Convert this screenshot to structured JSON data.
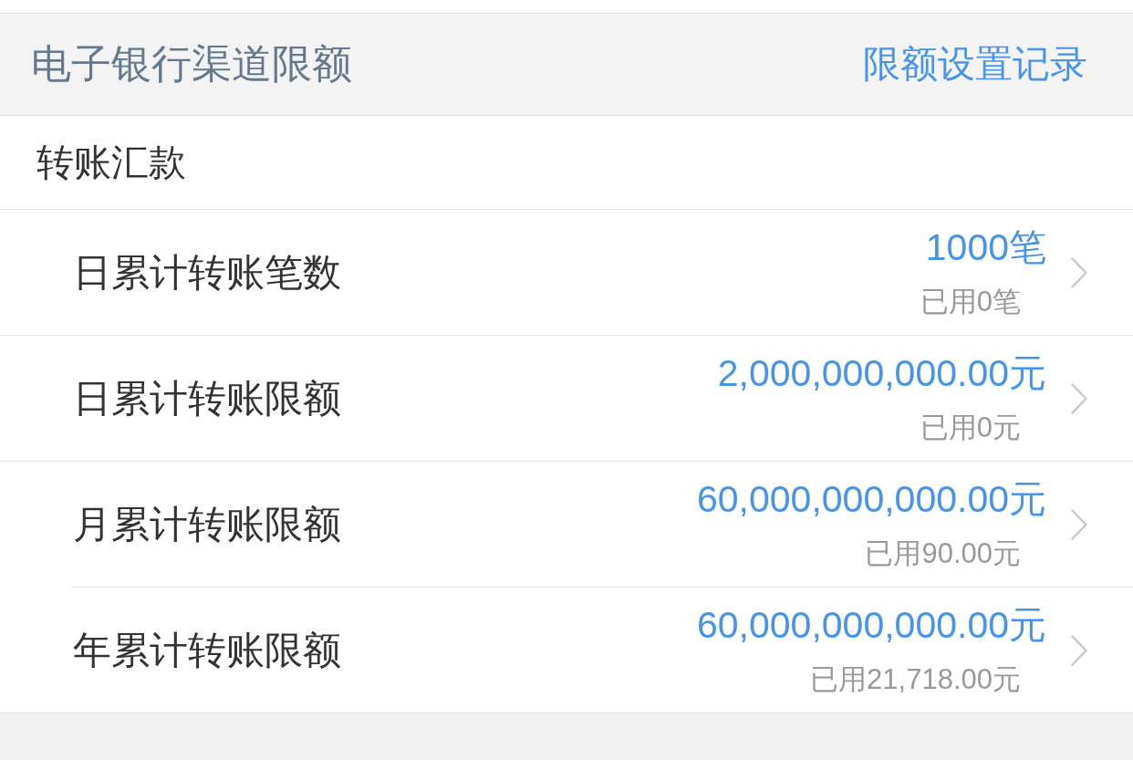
{
  "section_header": {
    "title": "电子银行渠道限额",
    "link": "限额设置记录"
  },
  "group": {
    "title": "转账汇款",
    "items": [
      {
        "label": "日累计转账笔数",
        "limit": "1000笔",
        "used": "已用0笔"
      },
      {
        "label": "日累计转账限额",
        "limit": "2,000,000,000.00元",
        "used": "已用0元"
      },
      {
        "label": "月累计转账限额",
        "limit": "60,000,000,000.00元",
        "used": "已用90.00元"
      },
      {
        "label": "年累计转账限额",
        "limit": "60,000,000,000.00元",
        "used": "已用21,718.00元"
      }
    ]
  }
}
